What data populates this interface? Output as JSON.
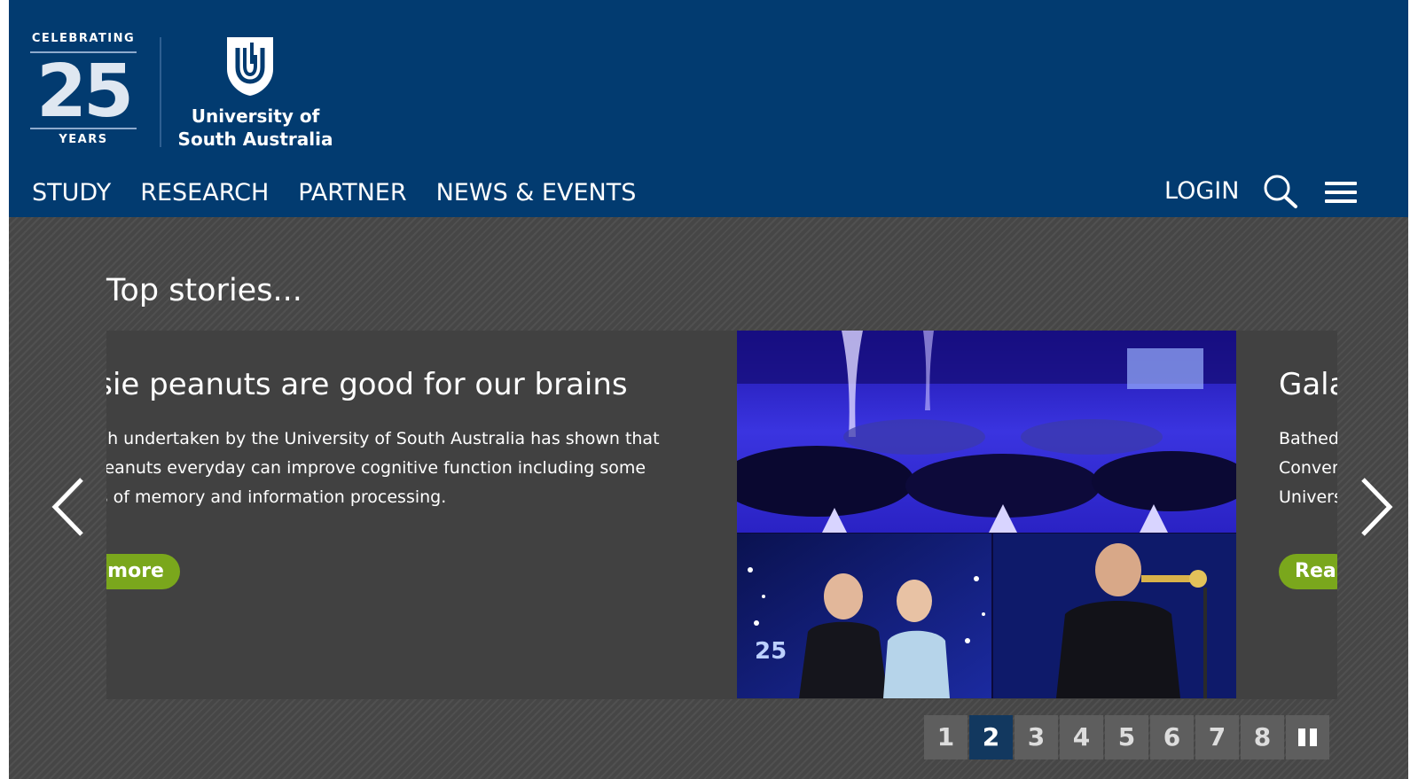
{
  "colors": {
    "header_bg": "#023b70",
    "section_bg": "#4a4a4a",
    "slide_bg": "#414141",
    "read_more_bg": "#7aa71c",
    "pager_bg": "#5e5e5e",
    "pager_active_bg": "#12385f"
  },
  "logo": {
    "celebrating": "CELEBRATING",
    "number": "25",
    "years": "YEARS",
    "university_line1": "University of",
    "university_line2": "South Australia",
    "shield_icon": "unisa-shield-icon"
  },
  "nav": {
    "items": [
      "STUDY",
      "RESEARCH",
      "PARTNER",
      "NEWS & EVENTS"
    ],
    "login_label": "LOGIN",
    "search_icon": "search-icon",
    "menu_icon": "hamburger-menu-icon"
  },
  "carousel": {
    "heading": "Top stories...",
    "current_slide": {
      "title": "ussie peanuts are good for our brains",
      "body_line1": "search undertaken by the University of South Australia has shown that",
      "body_line2": "ing peanuts everyday can improve cognitive function including some",
      "body_line3": "pects of memory and information processing.",
      "button_label": "ead more",
      "image_alt": "Gala dinner collage: banquet hall in blue light, couple at event, trumpet player"
    },
    "next_slide": {
      "title": "Gala",
      "body_line1": "Bathed",
      "body_line2": "Conver",
      "body_line3": "Univers",
      "button_label": "Rea"
    },
    "prev_icon": "chevron-left-icon",
    "next_icon": "chevron-right-icon",
    "pages": [
      "1",
      "2",
      "3",
      "4",
      "5",
      "6",
      "7",
      "8"
    ],
    "active_page": "2",
    "pause_icon": "pause-icon"
  }
}
